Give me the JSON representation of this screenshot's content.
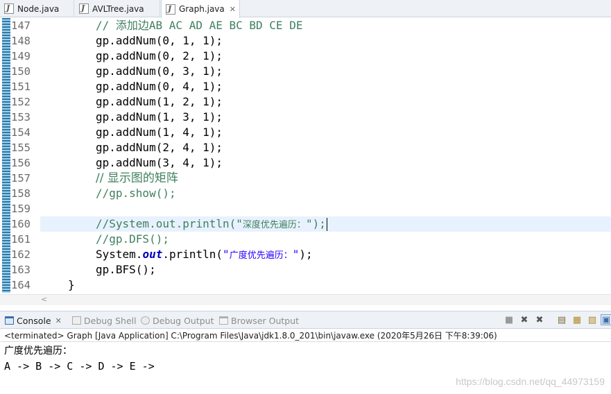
{
  "tabs": [
    {
      "label": "Node.java",
      "active": false
    },
    {
      "label": "AVLTree.java",
      "active": false
    },
    {
      "label": "Graph.java",
      "active": true
    }
  ],
  "editor": {
    "line_numbers": [
      "147",
      "148",
      "149",
      "150",
      "151",
      "152",
      "153",
      "154",
      "155",
      "156",
      "157",
      "158",
      "159",
      "160",
      "161",
      "162",
      "163",
      "164"
    ],
    "lines": {
      "l147": "// 添加边AB AC AD AE BC BD CE DE",
      "l148": "gp.addNum(0, 1, 1);",
      "l149": "gp.addNum(0, 2, 1);",
      "l150": "gp.addNum(0, 3, 1);",
      "l151": "gp.addNum(0, 4, 1);",
      "l152": "gp.addNum(1, 2, 1);",
      "l153": "gp.addNum(1, 3, 1);",
      "l154": "gp.addNum(1, 4, 1);",
      "l155": "gp.addNum(2, 4, 1);",
      "l156": "gp.addNum(3, 4, 1);",
      "l157": "// 显示图的矩阵",
      "l158": "//gp.show();",
      "l160_a": "//System.out.println(\"",
      "l160_b": "深度优先遍历：",
      "l160_c": "\");",
      "l161": "//gp.DFS();",
      "l162_a": "System.",
      "l162_b": "out",
      "l162_c": ".println(",
      "l162_d": "\"",
      "l162_e": "广度优先遍历：",
      "l162_f": "\"",
      "l162_g": ");",
      "l163": "gp.BFS();",
      "l164": "}"
    }
  },
  "scroll_arrow": "<",
  "console": {
    "tabs": [
      {
        "label": "Console",
        "active": true
      },
      {
        "label": "Debug Shell",
        "active": false
      },
      {
        "label": "Debug Output",
        "active": false
      },
      {
        "label": "Browser Output",
        "active": false
      }
    ],
    "status": "<terminated> Graph [Java Application] C:\\Program Files\\Java\\jdk1.8.0_201\\bin\\javaw.exe (2020年5月26日 下午8:39:06)",
    "output": [
      "广度优先遍历：",
      "A -> B -> C -> D -> E ->"
    ],
    "watermark": "https://blog.csdn.net/qq_44973159"
  },
  "colors": {
    "comment": "#3f7f5f",
    "string": "#2a00ff",
    "field": "#0000c0",
    "current_line": "#e8f2fe",
    "annotation_bar": "#2f78a8"
  }
}
